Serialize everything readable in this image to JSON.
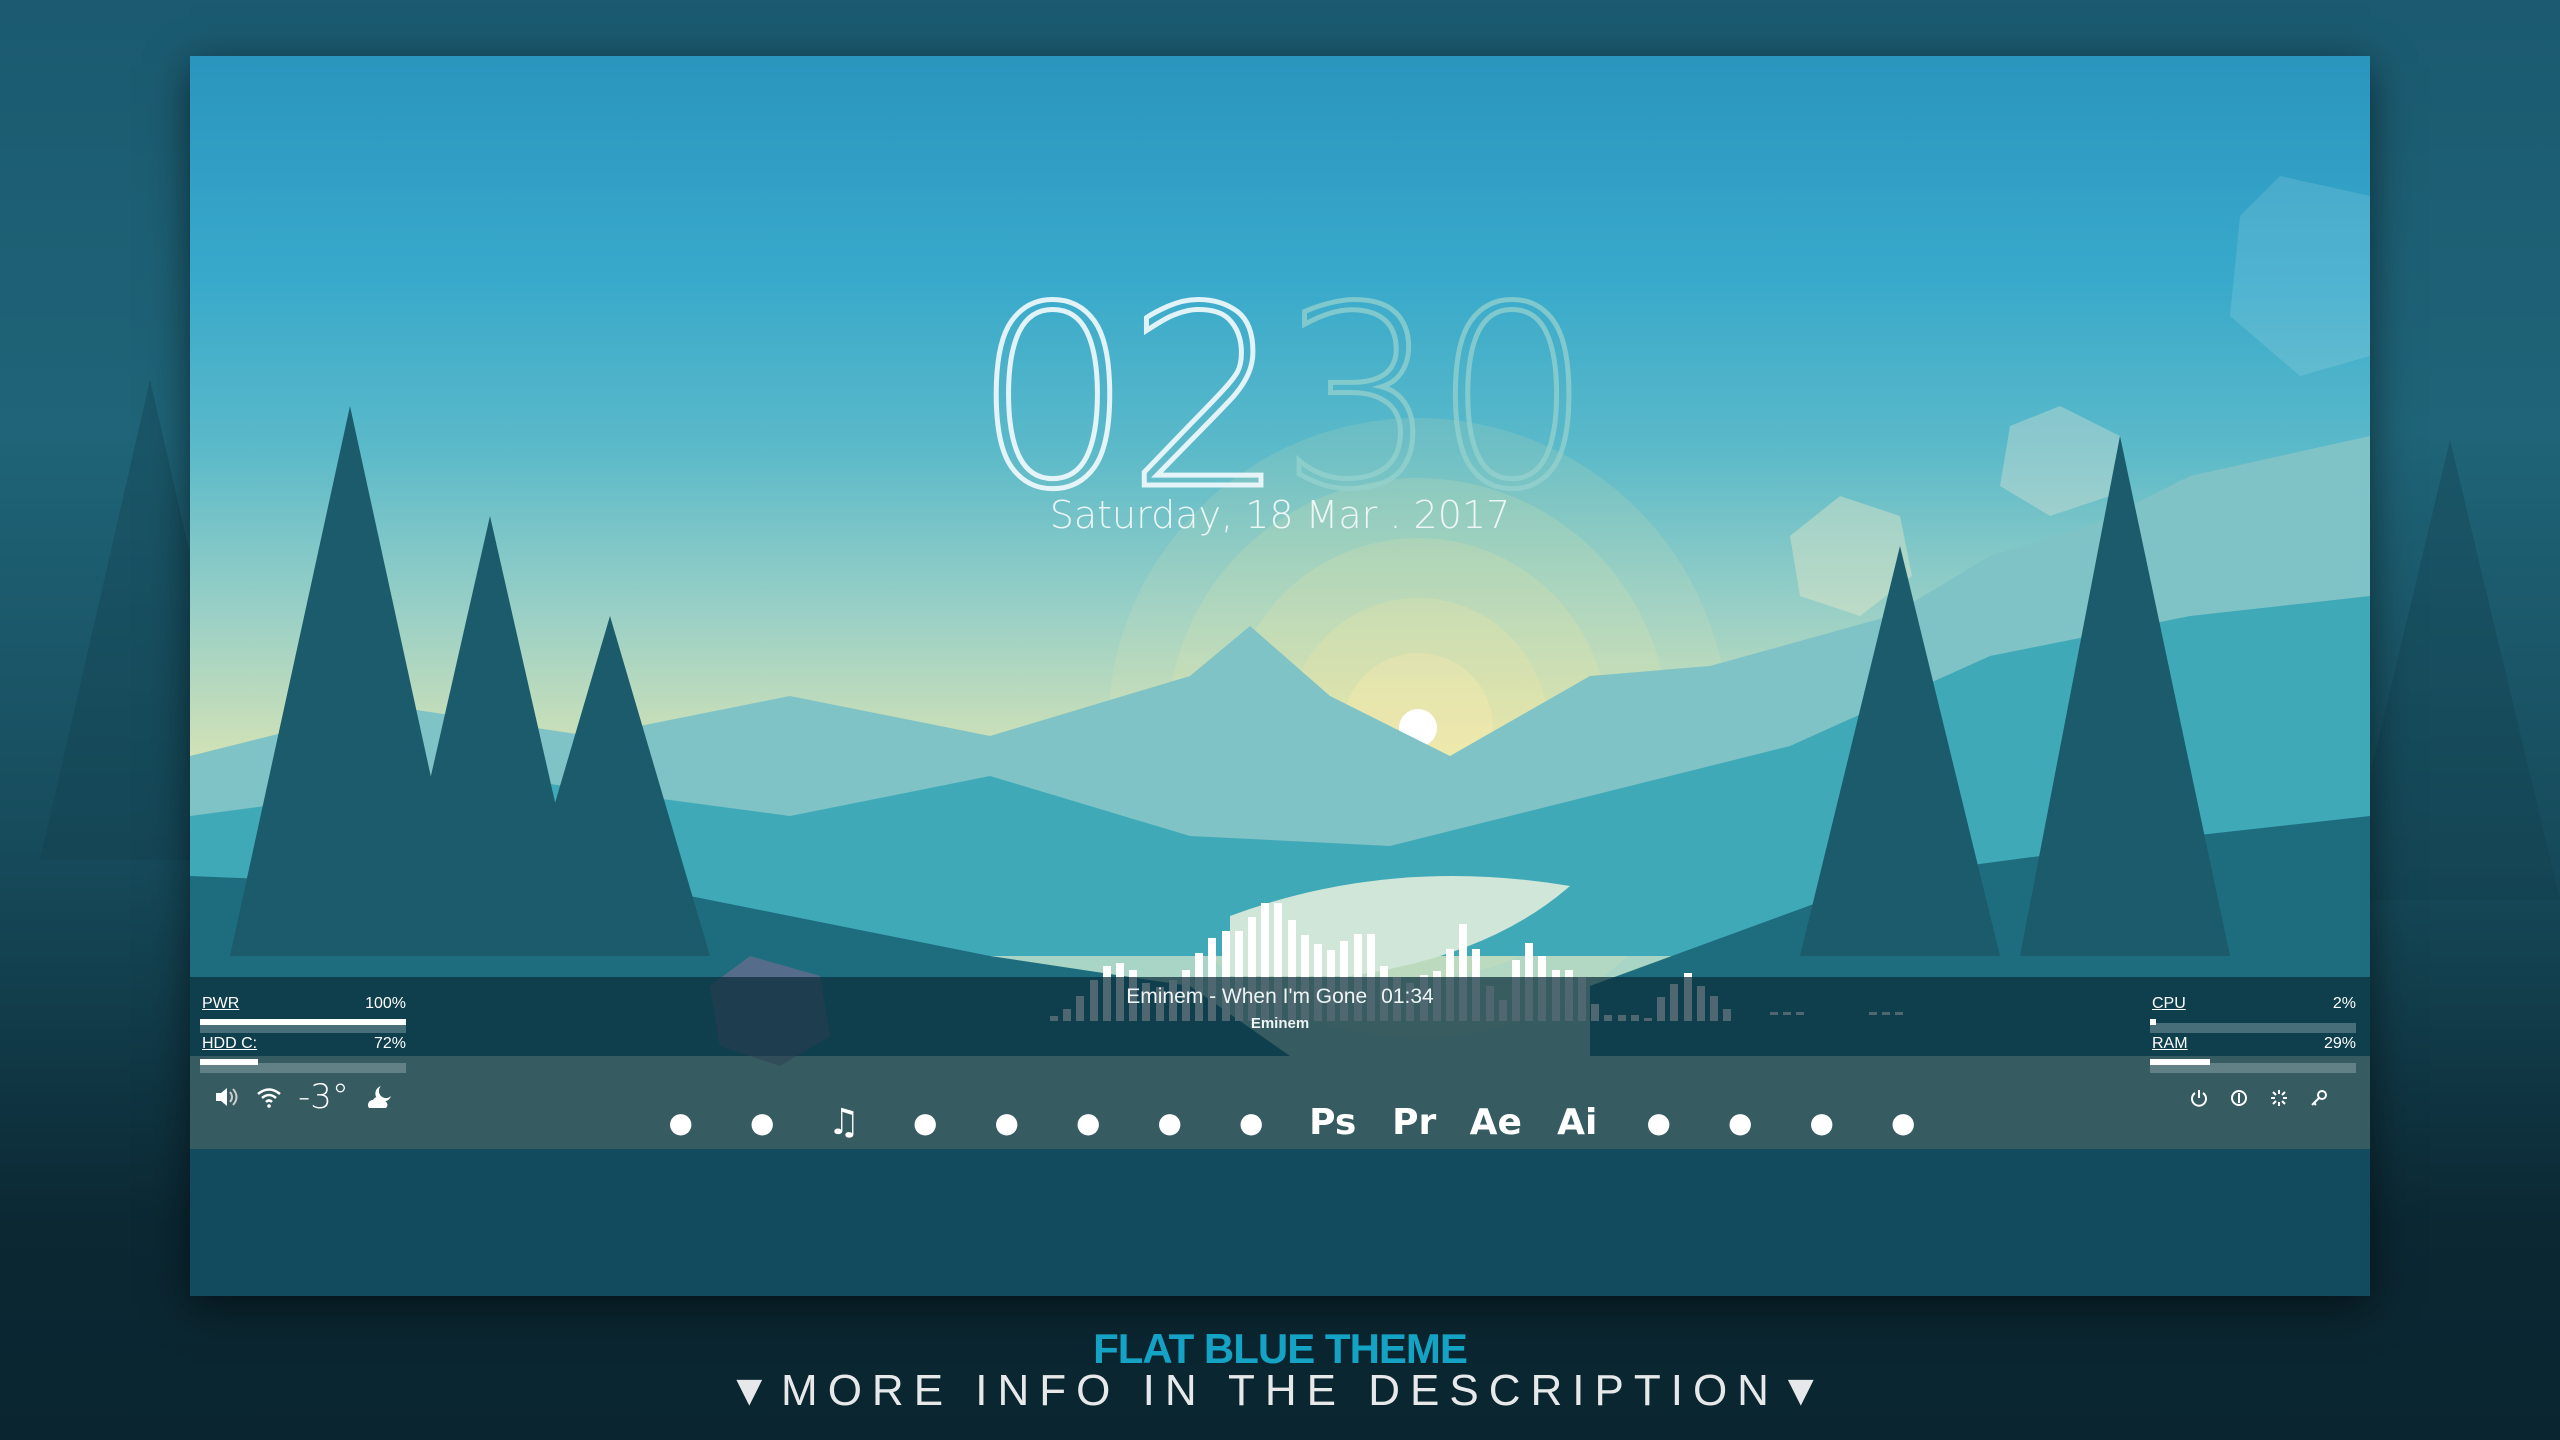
{
  "clock": {
    "hours": "02",
    "minutes": "30"
  },
  "date": "Saturday, 18 Mar . 2017",
  "now_playing": {
    "track": "Eminem - When I'm Gone",
    "time": "01:34",
    "artist": "Eminem"
  },
  "visualizer": {
    "levels": [
      0.04,
      0.1,
      0.21,
      0.35,
      0.47,
      0.49,
      0.43,
      0.32,
      0.29,
      0.35,
      0.43,
      0.58,
      0.7,
      0.76,
      0.76,
      0.88,
      1.0,
      1.0,
      0.86,
      0.73,
      0.65,
      0.6,
      0.68,
      0.74,
      0.74,
      0.47,
      0.37,
      0.32,
      0.39,
      0.42,
      0.61,
      0.82,
      0.61,
      0.3,
      0.18,
      0.52,
      0.66,
      0.55,
      0.43,
      0.43,
      0.37,
      0.14,
      0.05,
      0.05,
      0.05,
      0.02,
      0.2,
      0.31,
      0.41,
      0.3,
      0.21,
      0.1
    ],
    "dash_count": 6
  },
  "left_meters": [
    {
      "label": "PWR",
      "value": "100%",
      "fill": 1.0
    },
    {
      "label": "HDD C:",
      "value": "72%",
      "fill": 0.28
    }
  ],
  "right_meters": [
    {
      "label": "CPU",
      "value": "2%",
      "fill": 0.02
    },
    {
      "label": "RAM",
      "value": "29%",
      "fill": 0.29
    }
  ],
  "status": {
    "temperature": "-3°",
    "icons": [
      "volume-icon",
      "wifi-icon",
      "weather-night-cloudy-icon"
    ]
  },
  "apps": [
    {
      "name": "my-computer",
      "glyph": ""
    },
    {
      "name": "chrome",
      "glyph": ""
    },
    {
      "name": "music",
      "glyph": "♫"
    },
    {
      "name": "skype",
      "glyph": ""
    },
    {
      "name": "steam",
      "glyph": ""
    },
    {
      "name": "origin",
      "glyph": ""
    },
    {
      "name": "audio-file",
      "glyph": ""
    },
    {
      "name": "metronome",
      "glyph": ""
    },
    {
      "name": "photoshop",
      "glyph": "Ps"
    },
    {
      "name": "premiere",
      "glyph": "Pr"
    },
    {
      "name": "after-effects",
      "glyph": "Ae"
    },
    {
      "name": "illustrator",
      "glyph": "Ai"
    },
    {
      "name": "drop",
      "glyph": ""
    },
    {
      "name": "plane",
      "glyph": ""
    },
    {
      "name": "nvidia",
      "glyph": ""
    },
    {
      "name": "settings",
      "glyph": ""
    }
  ],
  "power_icons": [
    "power-icon",
    "restart-icon",
    "sleep-icon",
    "lock-key-icon"
  ],
  "footer": {
    "title": "FLAT BLUE THEME",
    "subtitle": "▼MORE INFO IN THE DESCRIPTION▼"
  }
}
